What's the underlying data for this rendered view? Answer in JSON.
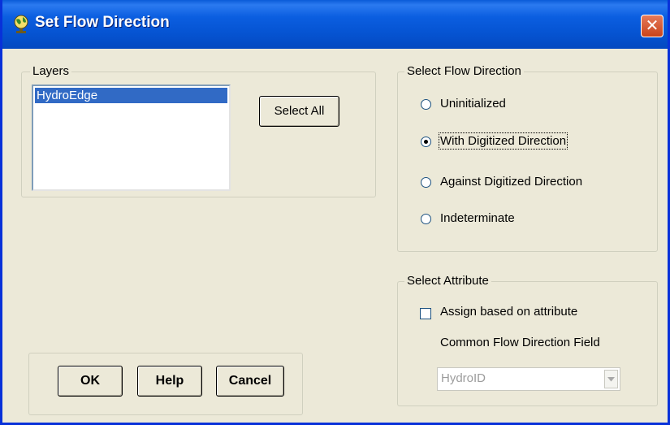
{
  "window": {
    "title": "Set Flow Direction",
    "close_glyph": "✕"
  },
  "layers": {
    "group_label": "Layers",
    "items": [
      "HydroEdge"
    ],
    "select_all_label": "Select All"
  },
  "flow_direction": {
    "group_label": "Select Flow Direction",
    "options": [
      {
        "label": "Uninitialized",
        "selected": false
      },
      {
        "label": "With Digitized Direction",
        "selected": true
      },
      {
        "label": "Against Digitized Direction",
        "selected": false
      },
      {
        "label": "Indeterminate",
        "selected": false
      }
    ]
  },
  "attribute": {
    "group_label": "Select Attribute",
    "checkbox_label": "Assign based on attribute",
    "checkbox_checked": false,
    "field_label": "Common Flow Direction Field",
    "field_value": "HydroID"
  },
  "buttons": {
    "ok": "OK",
    "help": "Help",
    "cancel": "Cancel"
  },
  "icons": {
    "app": "globe-icon",
    "close": "close-icon",
    "dropdown": "dropdown-arrow-icon"
  },
  "colors": {
    "titlebar": "#0553d1",
    "selection": "#316ac5",
    "close_button": "#c9431a",
    "dialog_bg": "#ece9d8"
  }
}
